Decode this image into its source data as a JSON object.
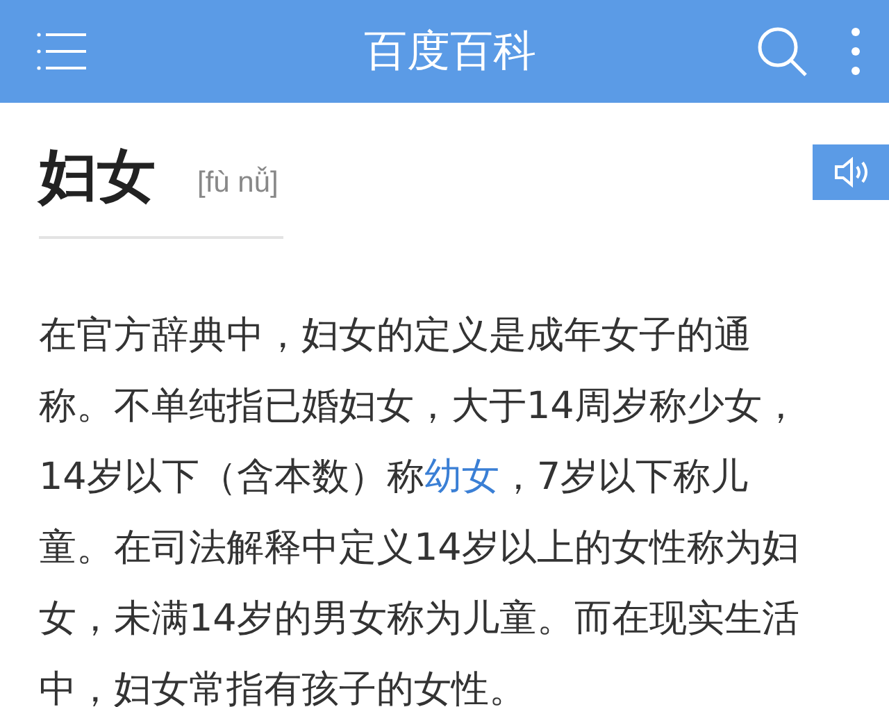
{
  "app_bar": {
    "title": "百度百科"
  },
  "entry": {
    "headword": "妇女",
    "pinyin": "[fù nǚ]"
  },
  "paragraph": {
    "text_before": "在官方辞典中，妇女的定义是成年女子的通称。不单纯指已婚妇女，大于14周岁称少女，14岁以下（含本数）称",
    "link": "幼女",
    "text_after": "，7岁以下称儿童。在司法解释中定义14岁以上的女性称为妇女，未满14岁的男女称为儿童。而在现实生活中，妇女常指有孩子的女性。"
  }
}
